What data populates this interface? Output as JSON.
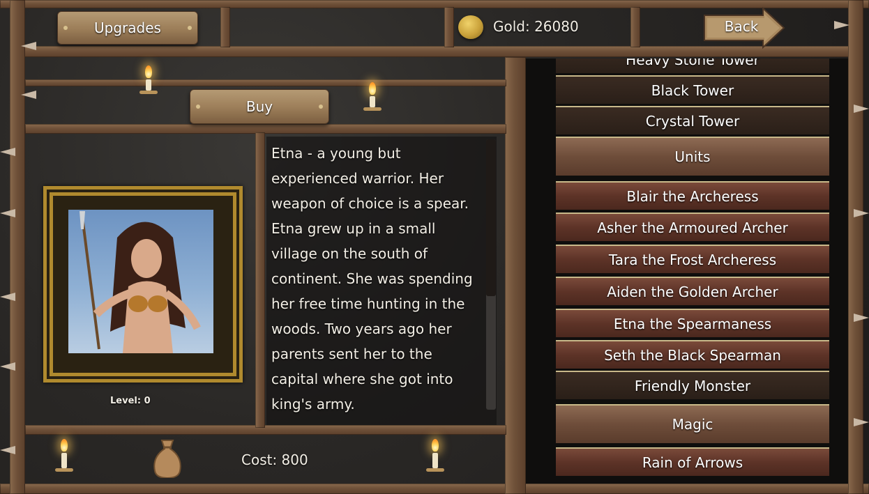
{
  "header": {
    "upgrades_label": "Upgrades",
    "gold_label": "Gold: 26080",
    "back_label": "Back"
  },
  "shop": {
    "buy_label": "Buy",
    "level_label": "Level: 0",
    "cost_label": "Cost: 800",
    "description_lines": [
      "Etna - a young but",
      "experienced warrior. Her",
      "weapon of choice is a spear.",
      "Etna grew up in a small",
      "village on the south of",
      "continent. She was spending",
      "her free time hunting in the",
      "woods. Two years ago her",
      "parents sent her to the",
      "capital where she got into",
      "king's army."
    ],
    "scroll_fraction_visible": 0.58
  },
  "list": {
    "items": [
      {
        "label": "Heavy Stone Tower",
        "style": "dark"
      },
      {
        "label": "Black Tower",
        "style": "dark"
      },
      {
        "label": "Crystal Tower",
        "style": "dark"
      },
      {
        "label": "Units",
        "style": "header"
      },
      {
        "label": "Blair the Archeress",
        "style": "red"
      },
      {
        "label": "Asher the Armoured Archer",
        "style": "red"
      },
      {
        "label": "Tara the Frost Archeress",
        "style": "red"
      },
      {
        "label": "Aiden the Golden Archer",
        "style": "red"
      },
      {
        "label": "Etna the Spearmaness",
        "style": "red"
      },
      {
        "label": "Seth the Black Spearman",
        "style": "red"
      },
      {
        "label": "Friendly Monster",
        "style": "dark"
      },
      {
        "label": "Magic",
        "style": "header"
      },
      {
        "label": "Rain of Arrows",
        "style": "red"
      }
    ]
  },
  "colors": {
    "wood": "#6f5139",
    "sign": "#9b7d58",
    "gold_coin": "#c9a13a",
    "frame_gold": "#b08a2e"
  }
}
